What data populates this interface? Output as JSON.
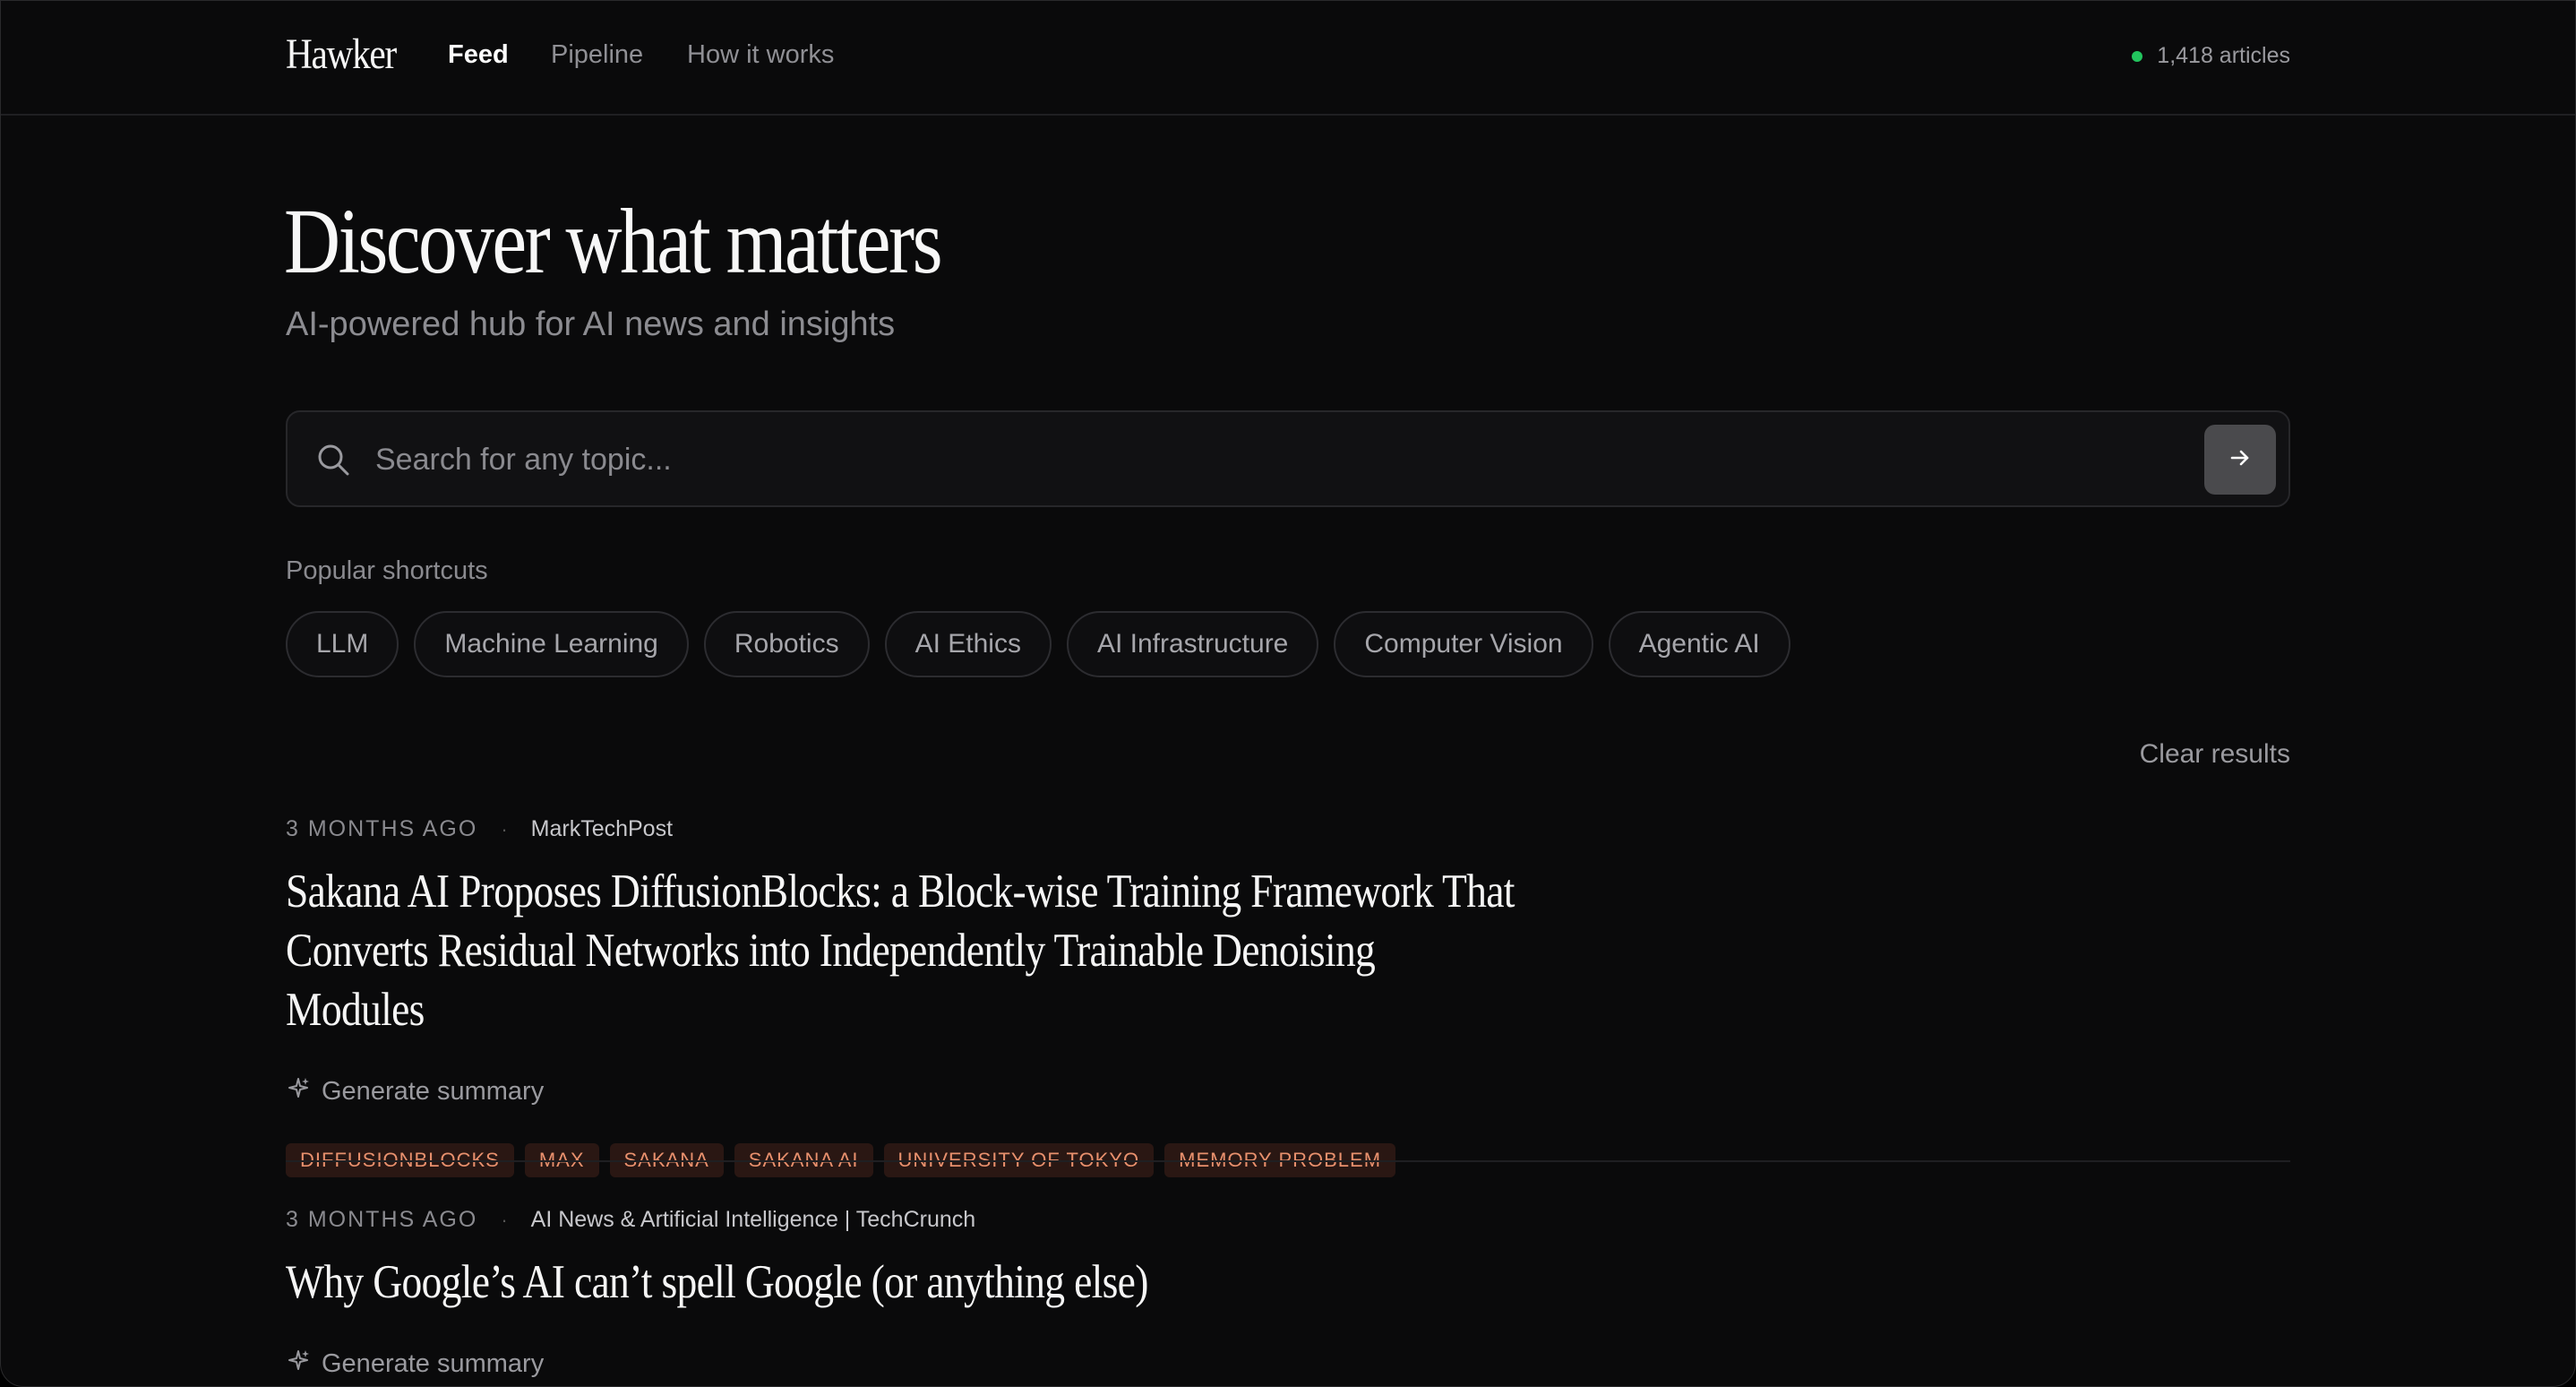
{
  "header": {
    "logo": "Hawker",
    "nav": {
      "feed": "Feed",
      "pipeline": "Pipeline",
      "how_it_works": "How it works"
    },
    "status_text": "1,418 articles",
    "status_color": "#22c55e"
  },
  "hero": {
    "title": "Discover what matters",
    "subtitle": "AI-powered hub for AI news and insights"
  },
  "search": {
    "placeholder": "Search for any topic...",
    "value": ""
  },
  "shortcuts": {
    "label": "Popular shortcuts",
    "items": [
      "LLM",
      "Machine Learning",
      "Robotics",
      "AI Ethics",
      "AI Infrastructure",
      "Computer Vision",
      "Agentic AI"
    ]
  },
  "results": {
    "clear_label": "Clear results"
  },
  "articles": [
    {
      "time": "3 MONTHS AGO",
      "source": "MarkTechPost",
      "title": "Sakana AI Proposes DiffusionBlocks: a Block-wise Training Framework That Converts Residual Networks into Independently Trainable Denoising Modules",
      "summary_label": "Generate summary",
      "tags": [
        "DIFFUSIONBLOCKS",
        "MAX",
        "SAKANA",
        "SAKANA AI",
        "UNIVERSITY OF TOKYO",
        "MEMORY PROBLEM"
      ]
    },
    {
      "time": "3 MONTHS AGO",
      "source": "AI News & Artificial Intelligence | TechCrunch",
      "title": "Why Google’s AI can’t spell Google (or anything else)",
      "summary_label": "Generate summary"
    }
  ],
  "colors": {
    "background": "#0a0a0b",
    "tag_text": "#e8906d",
    "tag_bg": "#2a1713"
  },
  "icons": {
    "search": "search-icon",
    "submit": "arrow-right-icon",
    "summary": "sparkle-icon"
  }
}
